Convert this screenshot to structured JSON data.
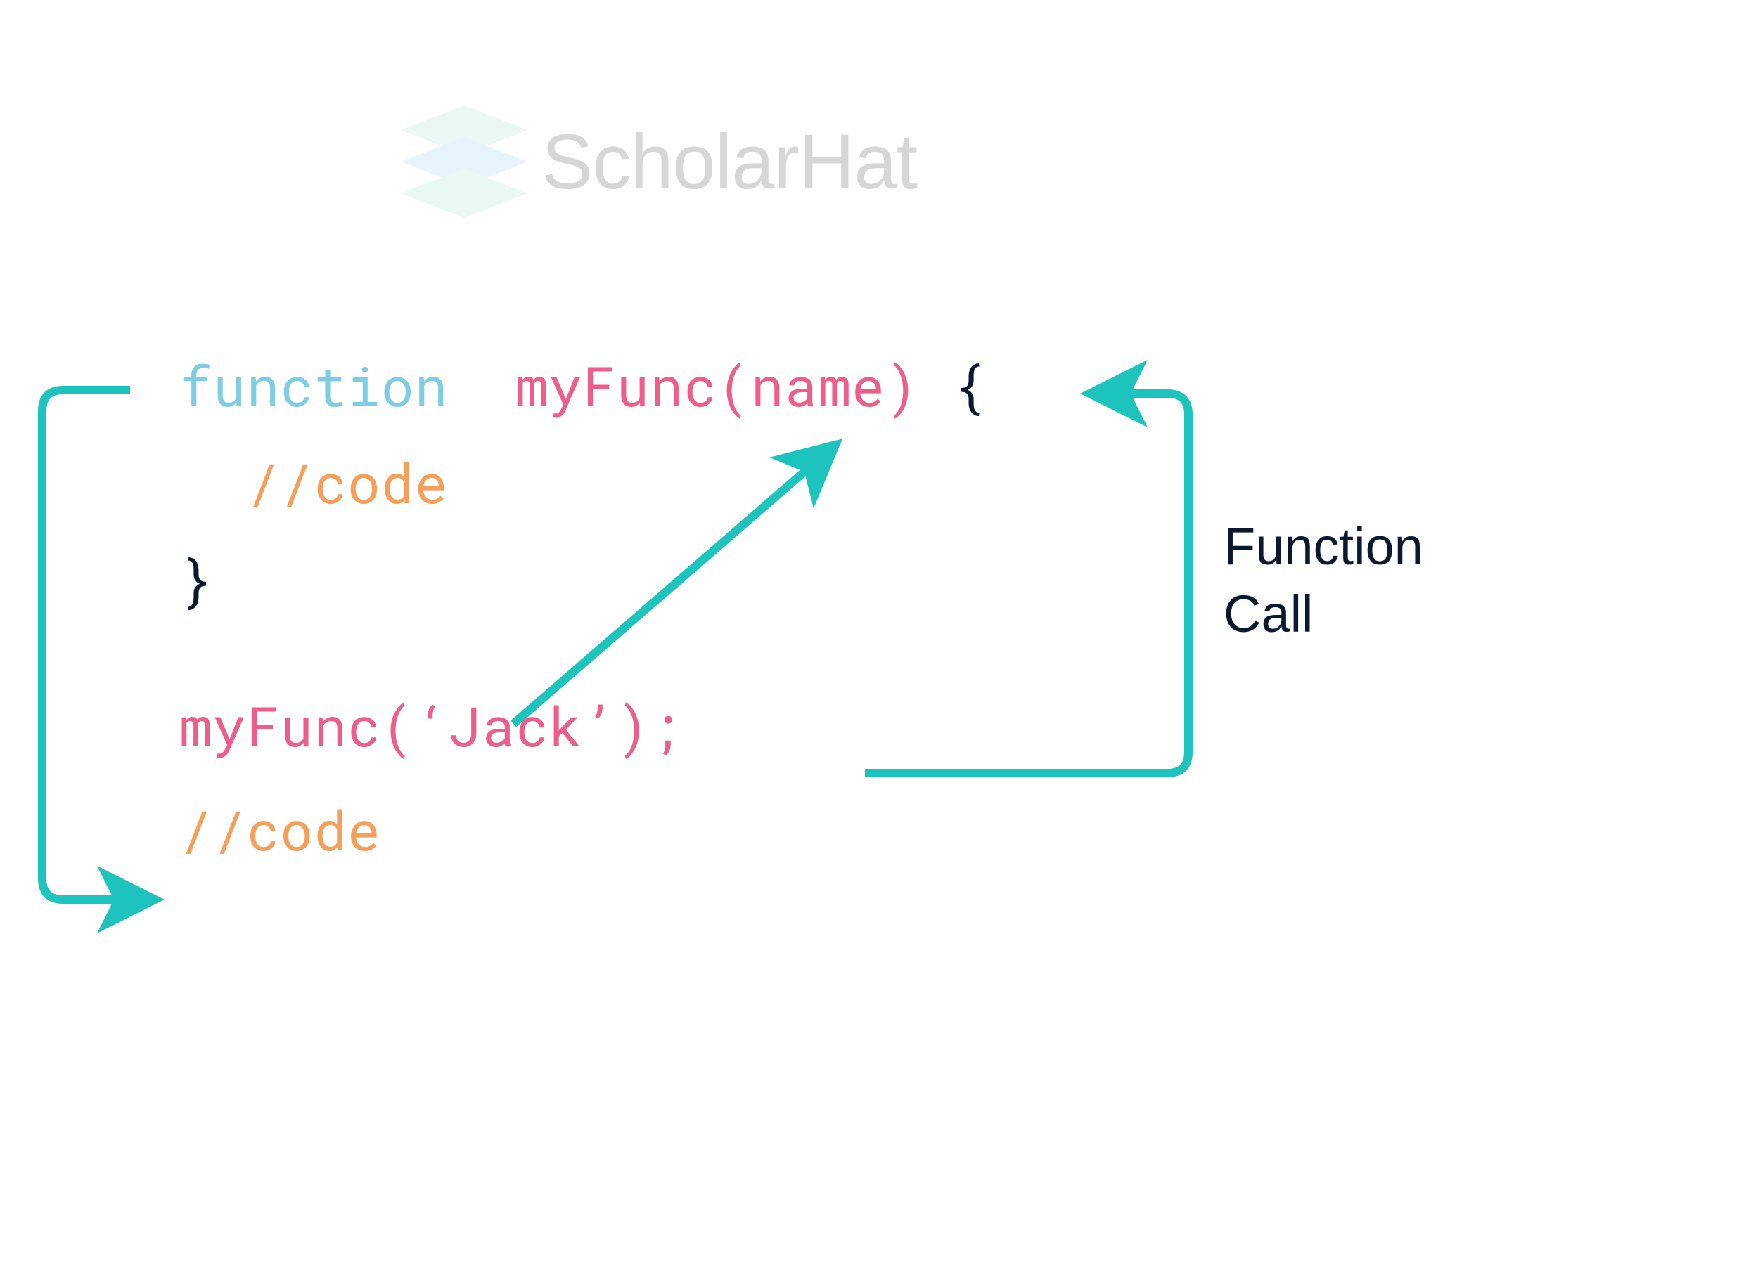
{
  "logo": {
    "brand": "ScholarHat",
    "icon_name": "stacked-layers-icon",
    "colors": {
      "top": "#c5ede3",
      "middle": "#b6def4",
      "bottom": "#c5ede3"
    }
  },
  "code": {
    "line1_keyword": "function",
    "line1_signature": "myFunc(name)",
    "line1_brace": "{",
    "line2_comment": "//code",
    "line3_brace": "}",
    "line4_call": "myFunc(‘Jack’);",
    "line5_comment": "//code"
  },
  "annotation": {
    "function_call_line1": "Function",
    "function_call_line2": "Call"
  },
  "arrows": {
    "color": "#1cc4bd",
    "stroke_width": 12
  }
}
